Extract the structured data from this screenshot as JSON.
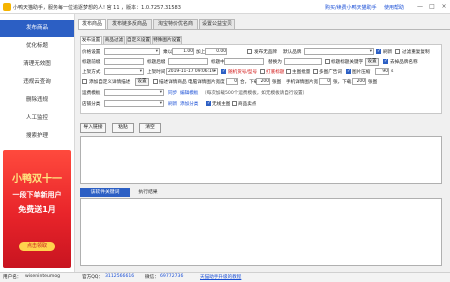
{
  "app": {
    "title": "小鸭天猫助手，服务每一位追逐梦想的人! 官 11 ，版本：1.0.7257.31583",
    "link_forum": "购买/续费小鸭天猫助手",
    "link_help": "使用帮助"
  },
  "sidebar": {
    "items": [
      {
        "label": "发布商品"
      },
      {
        "label": "优化标题"
      },
      {
        "label": "清理无效图"
      },
      {
        "label": "违规云查询"
      },
      {
        "label": "删除违规"
      },
      {
        "label": "人工监控"
      },
      {
        "label": "搜索护理"
      }
    ],
    "promo": {
      "title": "小鸭双十一",
      "line1": "一段下单新用户",
      "line2": "免费送1月",
      "button": "点击领取"
    }
  },
  "tabs": [
    {
      "label": "发布商品"
    },
    {
      "label": "发布链多反商品"
    },
    {
      "label": "淘宝特价优名商"
    },
    {
      "label": "设置公益宝贝"
    }
  ],
  "subtabs": [
    {
      "label": "发布设置"
    },
    {
      "label": "商品过滤"
    },
    {
      "label": "自定义设置"
    },
    {
      "label": "特殊图片设置"
    }
  ],
  "form": {
    "price_label": "价格设置",
    "price_value": "",
    "multiply_label": "乘以",
    "multiply_value": "1.00",
    "add_label": "加上",
    "add_value": "0.00",
    "cb_no_brand": "发布无品牌",
    "default_brand_label": "默认品牌",
    "cb_refresh": "刷新",
    "cb_filter_keywords": "过滤关键词",
    "cb_filter_duplicate": "过滤重复复制",
    "title_prefix_label": "标题前缀",
    "title_suffix_label": "标题后缀",
    "title_replace_label": "标题中",
    "replace_to_label": "替换为",
    "cb_title_keyword": "标题标题关键字",
    "settings_btn": "设置",
    "cb_remove_brand": "去掉品牌名称",
    "shelf_label": "上架方式",
    "shelf_time_label": "上架时间",
    "shelf_time_value": "2019-11-17 09:06:19",
    "cb_random_id": "随机货号/型号",
    "cb_delivery": "打底标题",
    "cb_main_image": "主图批量",
    "cb_multi_image": "多图广告词",
    "cb_image_compress": "图片压缩",
    "compress_value": "90",
    "compress_unit": "s",
    "cb_add_desc": "添加自定义详情描述",
    "settings_btn2": "设置",
    "cb_desc_detail": "描述详情商品",
    "pc_width_label": "电脑详情图片宽度",
    "pc_width_value": "0",
    "count_label": "合，下载",
    "count_value": "200",
    "unit_pcs": "张图",
    "mobile_label": "手机详情图片宽",
    "mobile_value": "0",
    "count_label2": "张，下载",
    "count_value2": "200",
    "unit_pcs2": "张图",
    "freight_label": "运费模板",
    "freight_link": "同步",
    "freight_link2": "编辑模板",
    "freight_note": "（每次加载500个运费模板，如无模板请自行设置）",
    "category_label": "店铺分类",
    "category_link": "刷新",
    "category_link2": "添加分类",
    "cb_no_hot": "无线主图",
    "cb_sell_point": "商品卖点"
  },
  "actions": {
    "import_btn": "导入链接",
    "paste_btn": "粘贴",
    "clear_btn": "清空"
  },
  "results": {
    "tab_active": "该软件关键词",
    "tab_other": "执行结果"
  },
  "status": {
    "user_label": "用户名：",
    "user_value": "wiseninteumog",
    "qq_label": "官方QQ：",
    "qq_value": "3112566616",
    "wx_label": "微信：",
    "wx_value": "69772736",
    "link": "天猫助手升级的教程"
  }
}
